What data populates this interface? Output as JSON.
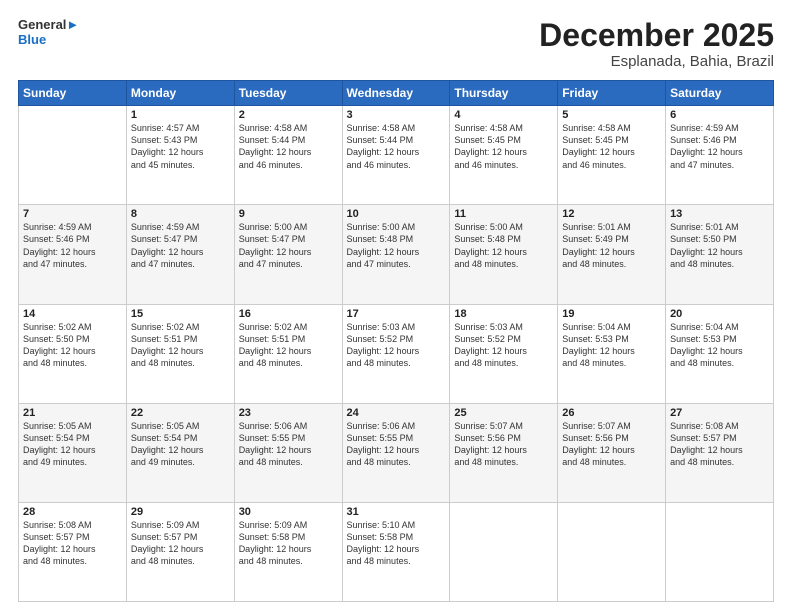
{
  "header": {
    "logo_line1": "General",
    "logo_line2": "Blue",
    "title": "December 2025",
    "subtitle": "Esplanada, Bahia, Brazil"
  },
  "days_of_week": [
    "Sunday",
    "Monday",
    "Tuesday",
    "Wednesday",
    "Thursday",
    "Friday",
    "Saturday"
  ],
  "weeks": [
    [
      {
        "day": "",
        "info": ""
      },
      {
        "day": "1",
        "info": "Sunrise: 4:57 AM\nSunset: 5:43 PM\nDaylight: 12 hours\nand 45 minutes."
      },
      {
        "day": "2",
        "info": "Sunrise: 4:58 AM\nSunset: 5:44 PM\nDaylight: 12 hours\nand 46 minutes."
      },
      {
        "day": "3",
        "info": "Sunrise: 4:58 AM\nSunset: 5:44 PM\nDaylight: 12 hours\nand 46 minutes."
      },
      {
        "day": "4",
        "info": "Sunrise: 4:58 AM\nSunset: 5:45 PM\nDaylight: 12 hours\nand 46 minutes."
      },
      {
        "day": "5",
        "info": "Sunrise: 4:58 AM\nSunset: 5:45 PM\nDaylight: 12 hours\nand 46 minutes."
      },
      {
        "day": "6",
        "info": "Sunrise: 4:59 AM\nSunset: 5:46 PM\nDaylight: 12 hours\nand 47 minutes."
      }
    ],
    [
      {
        "day": "7",
        "info": "Sunrise: 4:59 AM\nSunset: 5:46 PM\nDaylight: 12 hours\nand 47 minutes."
      },
      {
        "day": "8",
        "info": "Sunrise: 4:59 AM\nSunset: 5:47 PM\nDaylight: 12 hours\nand 47 minutes."
      },
      {
        "day": "9",
        "info": "Sunrise: 5:00 AM\nSunset: 5:47 PM\nDaylight: 12 hours\nand 47 minutes."
      },
      {
        "day": "10",
        "info": "Sunrise: 5:00 AM\nSunset: 5:48 PM\nDaylight: 12 hours\nand 47 minutes."
      },
      {
        "day": "11",
        "info": "Sunrise: 5:00 AM\nSunset: 5:48 PM\nDaylight: 12 hours\nand 48 minutes."
      },
      {
        "day": "12",
        "info": "Sunrise: 5:01 AM\nSunset: 5:49 PM\nDaylight: 12 hours\nand 48 minutes."
      },
      {
        "day": "13",
        "info": "Sunrise: 5:01 AM\nSunset: 5:50 PM\nDaylight: 12 hours\nand 48 minutes."
      }
    ],
    [
      {
        "day": "14",
        "info": "Sunrise: 5:02 AM\nSunset: 5:50 PM\nDaylight: 12 hours\nand 48 minutes."
      },
      {
        "day": "15",
        "info": "Sunrise: 5:02 AM\nSunset: 5:51 PM\nDaylight: 12 hours\nand 48 minutes."
      },
      {
        "day": "16",
        "info": "Sunrise: 5:02 AM\nSunset: 5:51 PM\nDaylight: 12 hours\nand 48 minutes."
      },
      {
        "day": "17",
        "info": "Sunrise: 5:03 AM\nSunset: 5:52 PM\nDaylight: 12 hours\nand 48 minutes."
      },
      {
        "day": "18",
        "info": "Sunrise: 5:03 AM\nSunset: 5:52 PM\nDaylight: 12 hours\nand 48 minutes."
      },
      {
        "day": "19",
        "info": "Sunrise: 5:04 AM\nSunset: 5:53 PM\nDaylight: 12 hours\nand 48 minutes."
      },
      {
        "day": "20",
        "info": "Sunrise: 5:04 AM\nSunset: 5:53 PM\nDaylight: 12 hours\nand 48 minutes."
      }
    ],
    [
      {
        "day": "21",
        "info": "Sunrise: 5:05 AM\nSunset: 5:54 PM\nDaylight: 12 hours\nand 49 minutes."
      },
      {
        "day": "22",
        "info": "Sunrise: 5:05 AM\nSunset: 5:54 PM\nDaylight: 12 hours\nand 49 minutes."
      },
      {
        "day": "23",
        "info": "Sunrise: 5:06 AM\nSunset: 5:55 PM\nDaylight: 12 hours\nand 48 minutes."
      },
      {
        "day": "24",
        "info": "Sunrise: 5:06 AM\nSunset: 5:55 PM\nDaylight: 12 hours\nand 48 minutes."
      },
      {
        "day": "25",
        "info": "Sunrise: 5:07 AM\nSunset: 5:56 PM\nDaylight: 12 hours\nand 48 minutes."
      },
      {
        "day": "26",
        "info": "Sunrise: 5:07 AM\nSunset: 5:56 PM\nDaylight: 12 hours\nand 48 minutes."
      },
      {
        "day": "27",
        "info": "Sunrise: 5:08 AM\nSunset: 5:57 PM\nDaylight: 12 hours\nand 48 minutes."
      }
    ],
    [
      {
        "day": "28",
        "info": "Sunrise: 5:08 AM\nSunset: 5:57 PM\nDaylight: 12 hours\nand 48 minutes."
      },
      {
        "day": "29",
        "info": "Sunrise: 5:09 AM\nSunset: 5:57 PM\nDaylight: 12 hours\nand 48 minutes."
      },
      {
        "day": "30",
        "info": "Sunrise: 5:09 AM\nSunset: 5:58 PM\nDaylight: 12 hours\nand 48 minutes."
      },
      {
        "day": "31",
        "info": "Sunrise: 5:10 AM\nSunset: 5:58 PM\nDaylight: 12 hours\nand 48 minutes."
      },
      {
        "day": "",
        "info": ""
      },
      {
        "day": "",
        "info": ""
      },
      {
        "day": "",
        "info": ""
      }
    ]
  ]
}
